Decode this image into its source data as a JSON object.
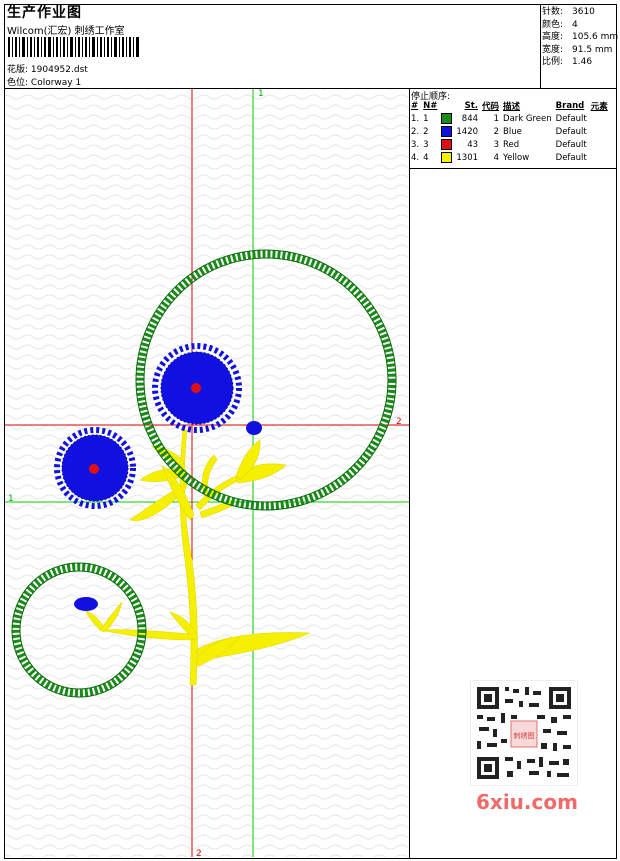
{
  "header": {
    "title": "生产作业图",
    "subtitle": "Wilcom(汇宏) 刺绣工作室",
    "design_label": "花版:",
    "design_value": "1904952.dst",
    "color_label": "色位:",
    "color_value": "Colorway 1"
  },
  "stats": {
    "stitches_label": "针数:",
    "stitches_value": "3610",
    "colors_label": "颜色:",
    "colors_value": "4",
    "height_label": "高度:",
    "height_value": "105.6 mm",
    "width_label": "宽度:",
    "width_value": "91.5 mm",
    "scale_label": "比例:",
    "scale_value": "1.46"
  },
  "legend": {
    "caption": "停止顺序:",
    "columns": [
      "#",
      "N#",
      "St.",
      "代码",
      "描述",
      "Brand",
      "元素"
    ],
    "rows": [
      {
        "index": "1.",
        "n": "1",
        "color": "#1a8a1a",
        "stitches": "844",
        "code": "1",
        "desc": "Dark Green",
        "brand": "Default"
      },
      {
        "index": "2.",
        "n": "2",
        "color": "#1010e0",
        "stitches": "1420",
        "code": "2",
        "desc": "Blue",
        "brand": "Default"
      },
      {
        "index": "3.",
        "n": "3",
        "color": "#e01010",
        "stitches": "43",
        "code": "3",
        "desc": "Red",
        "brand": "Default"
      },
      {
        "index": "4.",
        "n": "4",
        "color": "#f5f000",
        "stitches": "1301",
        "code": "4",
        "desc": "Yellow",
        "brand": "Default"
      }
    ]
  },
  "axes": {
    "v1_label": "1",
    "v2_label": "2",
    "h1_label": "1",
    "h2_label": "2",
    "green_color": "#00cc00",
    "red_color": "#e00000"
  },
  "watermark": {
    "logo_text": "6xiu.com",
    "seal_text": "刺绣图"
  }
}
